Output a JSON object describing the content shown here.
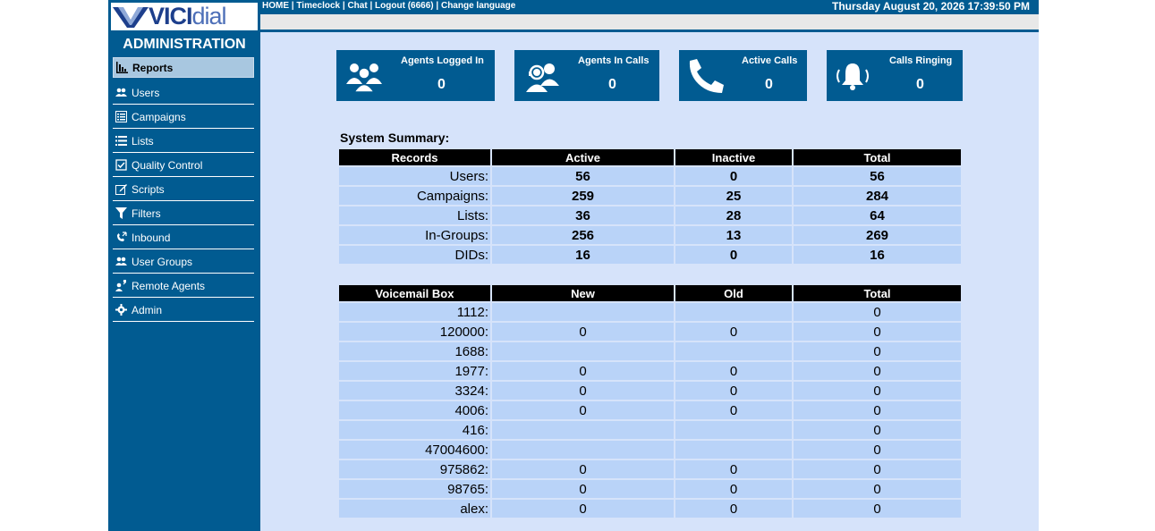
{
  "logo": {
    "brand_a": "VICI",
    "brand_b": "dial"
  },
  "sidebar": {
    "title": "ADMINISTRATION",
    "items": [
      {
        "label": "Reports",
        "icon": "bar-chart-icon",
        "active": true
      },
      {
        "label": "Users",
        "icon": "users-icon"
      },
      {
        "label": "Campaigns",
        "icon": "list-table-icon"
      },
      {
        "label": "Lists",
        "icon": "list-icon"
      },
      {
        "label": "Quality Control",
        "icon": "checkbox-icon"
      },
      {
        "label": "Scripts",
        "icon": "edit-icon"
      },
      {
        "label": "Filters",
        "icon": "filter-icon"
      },
      {
        "label": "Inbound",
        "icon": "phone-inbound-icon"
      },
      {
        "label": "User Groups",
        "icon": "users-icon"
      },
      {
        "label": "Remote Agents",
        "icon": "remote-agent-icon"
      },
      {
        "label": "Admin",
        "icon": "gear-icon"
      }
    ]
  },
  "header": {
    "links": [
      "HOME",
      "Timeclock",
      "Chat",
      "Logout (6666)",
      "Change language"
    ],
    "separator": " | ",
    "datetime": "Thursday August 20, 2026 17:39:50 PM"
  },
  "cards": [
    {
      "title": "Agents Logged In",
      "value": "0",
      "icon": "agents-group-icon"
    },
    {
      "title": "Agents In Calls",
      "value": "0",
      "icon": "headset-agents-icon"
    },
    {
      "title": "Active Calls",
      "value": "0",
      "icon": "phone-handset-icon"
    },
    {
      "title": "Calls Ringing",
      "value": "0",
      "icon": "ringing-bell-icon"
    }
  ],
  "summary": {
    "label": "System Summary:",
    "headers": [
      "Records",
      "Active",
      "Inactive",
      "Total"
    ],
    "rows": [
      [
        "Users:",
        "56",
        "0",
        "56"
      ],
      [
        "Campaigns:",
        "259",
        "25",
        "284"
      ],
      [
        "Lists:",
        "36",
        "28",
        "64"
      ],
      [
        "In-Groups:",
        "256",
        "13",
        "269"
      ],
      [
        "DIDs:",
        "16",
        "0",
        "16"
      ]
    ]
  },
  "voicemail": {
    "headers": [
      "Voicemail Box",
      "New",
      "Old",
      "Total"
    ],
    "rows": [
      [
        "1112:",
        "",
        "",
        "0"
      ],
      [
        "120000:",
        "0",
        "0",
        "0"
      ],
      [
        "1688:",
        "",
        "",
        "0"
      ],
      [
        "1977:",
        "0",
        "0",
        "0"
      ],
      [
        "3324:",
        "0",
        "0",
        "0"
      ],
      [
        "4006:",
        "0",
        "0",
        "0"
      ],
      [
        "416:",
        "",
        "",
        "0"
      ],
      [
        "47004600:",
        "",
        "",
        "0"
      ],
      [
        "975862:",
        "0",
        "0",
        "0"
      ],
      [
        "98765:",
        "0",
        "0",
        "0"
      ],
      [
        "alex:",
        "0",
        "0",
        "0"
      ]
    ]
  },
  "colors": {
    "primary": "#015b91",
    "content_bg": "#d6e3fa",
    "cell_bg": "#b9d3f8",
    "active_nav": "#a8c7e0"
  }
}
